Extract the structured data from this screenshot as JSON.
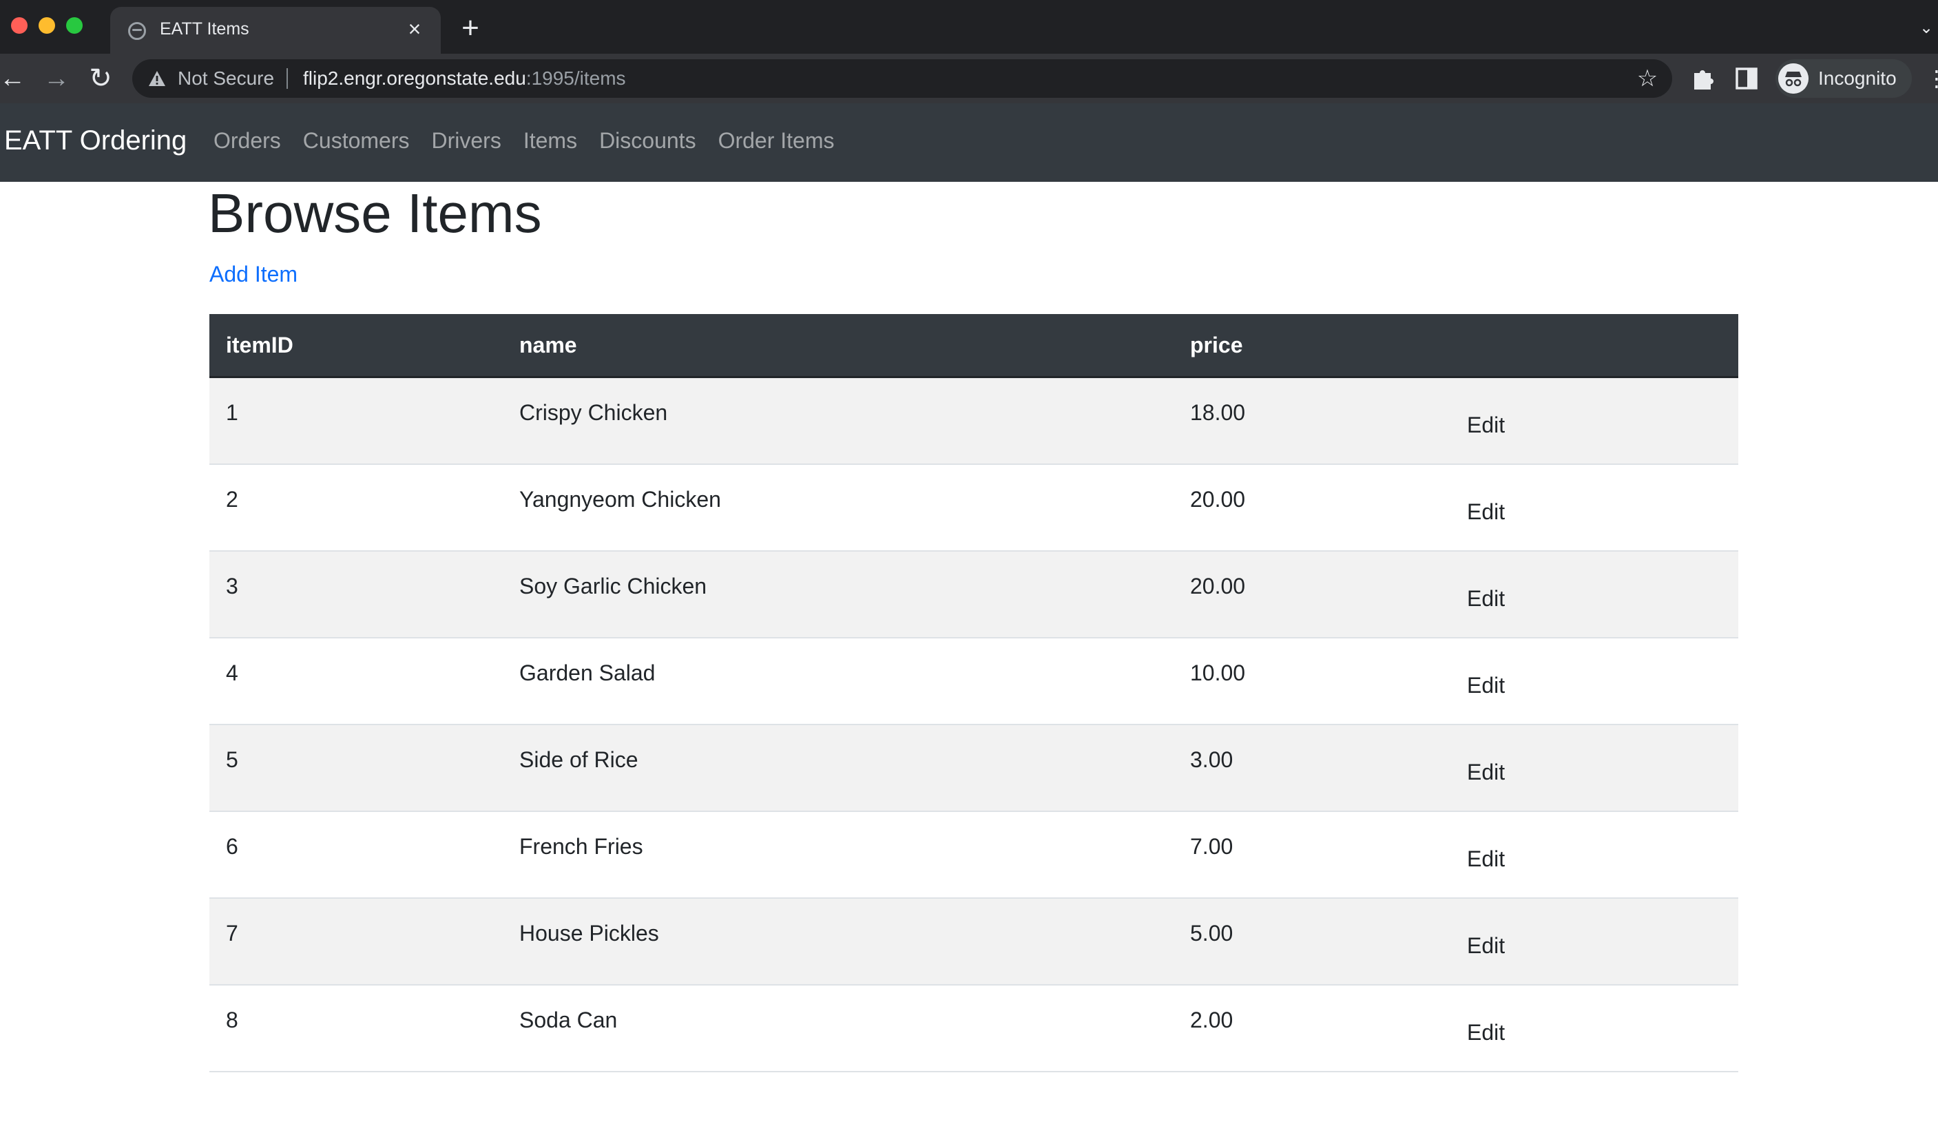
{
  "browser": {
    "tab_title": "EATT Items",
    "url_host": "flip2.engr.oregonstate.edu",
    "url_rest": ":1995/items",
    "security_label": "Not Secure",
    "profile_label": "Incognito"
  },
  "navbar": {
    "brand": "EATT Ordering",
    "links": [
      "Orders",
      "Customers",
      "Drivers",
      "Items",
      "Discounts",
      "Order Items"
    ]
  },
  "page": {
    "title": "Browse Items",
    "add_link": "Add Item"
  },
  "table": {
    "headers": [
      "itemID",
      "name",
      "price",
      ""
    ],
    "edit_label": "Edit",
    "rows": [
      {
        "id": "1",
        "name": "Crispy Chicken",
        "price": "18.00"
      },
      {
        "id": "2",
        "name": "Yangnyeom Chicken",
        "price": "20.00"
      },
      {
        "id": "3",
        "name": "Soy Garlic Chicken",
        "price": "20.00"
      },
      {
        "id": "4",
        "name": "Garden Salad",
        "price": "10.00"
      },
      {
        "id": "5",
        "name": "Side of Rice",
        "price": "3.00"
      },
      {
        "id": "6",
        "name": "French Fries",
        "price": "7.00"
      },
      {
        "id": "7",
        "name": "House Pickles",
        "price": "5.00"
      },
      {
        "id": "8",
        "name": "Soda Can",
        "price": "2.00"
      }
    ]
  }
}
